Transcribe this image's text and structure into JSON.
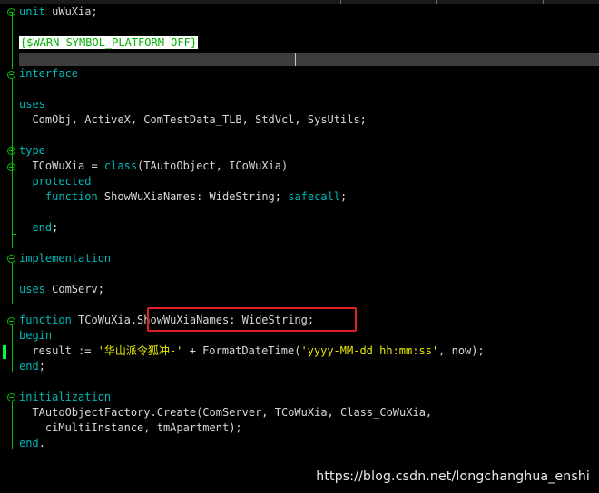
{
  "editor": {
    "lines": {
      "l1": {
        "kw": "unit",
        "rest": " uWuXia;"
      },
      "l2": {
        "directive": "{$WARN SYMBOL_PLATFORM OFF}"
      },
      "l3": {
        "kw": "interface"
      },
      "l4": {
        "kw": "uses"
      },
      "l5": {
        "text": "  ComObj, ActiveX, ComTestData_TLB, StdVcl, SysUtils;"
      },
      "l6": {
        "kw": "type"
      },
      "l7": {
        "pre": "  TCoWuXia = ",
        "kw": "class",
        "rest": "(TAutoObject, ICoWuXia)"
      },
      "l8": {
        "kw": "  protected"
      },
      "l9": {
        "pre": "    ",
        "kw": "function",
        "mid": " ShowWuXiaNames: WideString; ",
        "kw2": "safecall",
        "rest": ";"
      },
      "l10": {
        "pre": "  ",
        "kw": "end",
        "rest": ";"
      },
      "l11": {
        "kw": "implementation"
      },
      "l12": {
        "kw": "uses",
        "rest": " ComServ;"
      },
      "l13": {
        "kw": "function",
        "rest": " TCoWuXia.ShowWuXiaNames: WideString;"
      },
      "l14": {
        "kw": "begin"
      },
      "l15": {
        "pre": "  result := ",
        "str": "'华山派令狐冲-'",
        "mid": " + FormatDateTime(",
        "str2": "'yyyy-MM-dd hh:mm:ss'",
        "rest": ", now);"
      },
      "l16": {
        "kw": "end",
        "rest": ";"
      },
      "l17": {
        "kw": "initialization"
      },
      "l18": {
        "text": "  TAutoObjectFactory.Create(ComServer, TCoWuXia, Class_CoWuXia,"
      },
      "l19": {
        "text": "    ciMultiInstance, tmApartment);"
      },
      "l20": {
        "kw": "end",
        "rest": "."
      }
    }
  },
  "watermark": "https://blog.csdn.net/longchanghua_enshi",
  "colors": {
    "background": "#000000",
    "keyword": "#00b8b8",
    "string": "#e8e800",
    "comment": "#00b000",
    "gutter": "#00c400",
    "highlight_box": "#e02020"
  }
}
